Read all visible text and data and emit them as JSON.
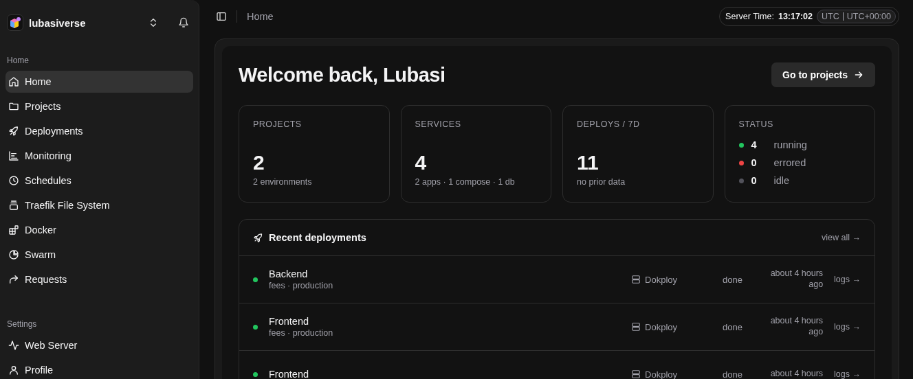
{
  "sidebar": {
    "workspace": "lubasiverse",
    "sections": [
      {
        "title": "Home",
        "items": [
          {
            "label": "Home",
            "selected": true
          },
          {
            "label": "Projects",
            "selected": false
          },
          {
            "label": "Deployments",
            "selected": false
          },
          {
            "label": "Monitoring",
            "selected": false
          },
          {
            "label": "Schedules",
            "selected": false
          },
          {
            "label": "Traefik File System",
            "selected": false
          },
          {
            "label": "Docker",
            "selected": false
          },
          {
            "label": "Swarm",
            "selected": false
          },
          {
            "label": "Requests",
            "selected": false
          }
        ]
      },
      {
        "title": "Settings",
        "items": [
          {
            "label": "Web Server",
            "selected": false
          },
          {
            "label": "Profile",
            "selected": false
          }
        ]
      }
    ]
  },
  "topbar": {
    "breadcrumb": "Home",
    "server_time_label": "Server Time:",
    "server_time": "13:17:02",
    "timezone": "UTC",
    "offset": "UTC+00:00"
  },
  "main": {
    "title": "Welcome back, Lubasi",
    "button": "Go to projects",
    "stats": [
      {
        "kind": "number",
        "label": "PROJECTS",
        "value": "2",
        "caption": "2 environments"
      },
      {
        "kind": "number",
        "label": "SERVICES",
        "value": "4",
        "caption": "2 apps · 1 compose · 1 db"
      },
      {
        "kind": "number",
        "label": "DEPLOYS / 7D",
        "value": "11",
        "caption": "no prior data"
      },
      {
        "kind": "status",
        "label": "STATUS",
        "items": [
          {
            "count": "4",
            "label": "running",
            "color": "#22c55e"
          },
          {
            "count": "0",
            "label": "errored",
            "color": "#ef4444"
          },
          {
            "count": "0",
            "label": "idle",
            "color": "#52525b"
          }
        ]
      }
    ],
    "deployments": {
      "title": "Recent deployments",
      "view_all": "view all →",
      "rows": [
        {
          "name": "Backend",
          "subtitle": "fees · production",
          "color": "#22c55e",
          "source": "Dokploy",
          "status": "done",
          "time": "about 4 hours ago",
          "link": "logs →"
        },
        {
          "name": "Frontend",
          "subtitle": "fees · production",
          "color": "#22c55e",
          "source": "Dokploy",
          "status": "done",
          "time": "about 4 hours ago",
          "link": "logs →"
        },
        {
          "name": "Frontend",
          "color": "#22c55e",
          "source": "Dokploy",
          "status": "done",
          "time": "about 4 hours",
          "link": "logs →"
        }
      ]
    }
  }
}
